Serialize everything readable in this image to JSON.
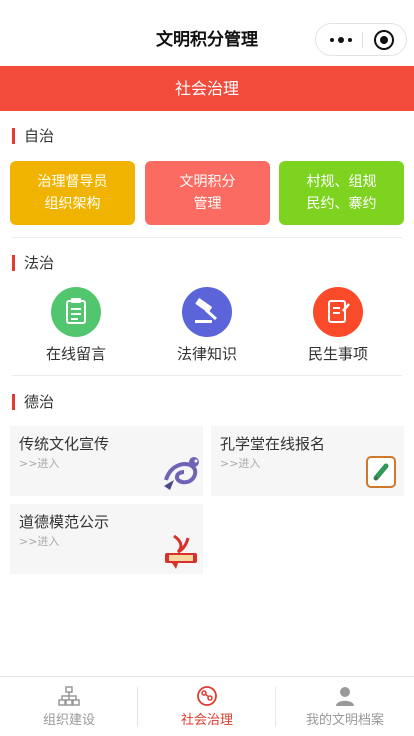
{
  "navbar": {
    "title": "文明积分管理",
    "more_icon": "more-dots-icon",
    "close_icon": "target-icon"
  },
  "header": {
    "title": "社会治理",
    "color": "#f24b3b"
  },
  "sections": {
    "zizhi": {
      "title": "自治",
      "tiles": [
        {
          "label": "治理督导员\n组织架构",
          "color": "#f0b400"
        },
        {
          "label": "文明积分\n管理",
          "color": "#fc6b62"
        },
        {
          "label": "村规、组规\n民约、寨约",
          "color": "#7ed321"
        }
      ]
    },
    "fazhi": {
      "title": "法治",
      "items": [
        {
          "label": "在线留言",
          "icon": "clipboard-icon",
          "color": "#52c66f"
        },
        {
          "label": "法律知识",
          "icon": "gavel-icon",
          "color": "#5b64d8"
        },
        {
          "label": "民生事项",
          "icon": "edit-document-icon",
          "color": "#fb4a2a"
        }
      ]
    },
    "dezhi": {
      "title": "德治",
      "cards": [
        {
          "title": "传统文化宣传",
          "sub": ">>进入",
          "icon": "dragon-icon"
        },
        {
          "title": "孔学堂在线报名",
          "sub": ">>进入",
          "icon": "pencil-note-icon"
        },
        {
          "title": "道德模范公示",
          "sub": ">>进入",
          "icon": "moral-model-badge-icon"
        }
      ]
    }
  },
  "tabbar": {
    "tabs": [
      {
        "label": "组织建设",
        "icon": "org-structure-icon",
        "active": false
      },
      {
        "label": "社会治理",
        "icon": "social-governance-icon",
        "active": true
      },
      {
        "label": "我的文明档案",
        "icon": "user-profile-icon",
        "active": false
      }
    ],
    "active_color": "#e03b32",
    "inactive_color": "#999999"
  }
}
